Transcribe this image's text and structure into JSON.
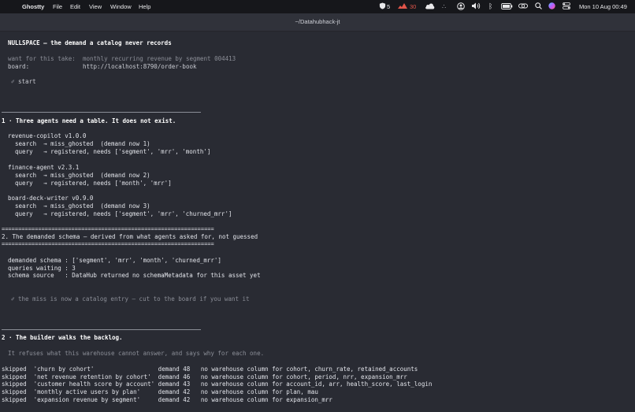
{
  "menubar": {
    "app_name": "Ghostty",
    "menus": [
      "File",
      "Edit",
      "View",
      "Window",
      "Help"
    ],
    "status": {
      "ghost_count": "5",
      "temp": "30",
      "datetime": "Mon 10 Aug  00:49"
    }
  },
  "window": {
    "title": "~/Datahubhack-jt"
  },
  "terminal": {
    "header": "NULLSPACE — the demand a catalog never records",
    "want_label": "want for this take:",
    "want_value": "monthly recurring revenue by segment 004413",
    "board_label": "board:",
    "board_value": "http://localhost:8790/order-book",
    "start": "start",
    "s1_title": "1 · Three agents need a table. It does not exist.",
    "agents": [
      {
        "name": "revenue-copilot v1.0.0",
        "search": "  search  → miss_ghosted  (demand now 1)",
        "query": "  query   → registered, needs ['segment', 'mrr', 'month']"
      },
      {
        "name": "finance-agent v2.3.1",
        "search": "  search  → miss_ghosted  (demand now 2)",
        "query": "  query   → registered, needs ['month', 'mrr']"
      },
      {
        "name": "board-deck-writer v0.9.0",
        "search": "  search  → miss_ghosted  (demand now 3)",
        "query": "  query   → registered, needs ['segment', 'mrr', 'churned_mrr']"
      }
    ],
    "equals_rule": "================================================================",
    "s2_title": "2. The demanded schema — derived from what agents asked for, not guessed",
    "schema_lines": [
      "demanded schema : ['segment', 'mrr', 'month', 'churned_mrr']",
      "queries waiting : 3",
      "schema source   : DataHub returned no schemaMetadata for this asset yet"
    ],
    "miss_note": "the miss is now a catalog entry — cut to the board if you want it",
    "s3_title": "2 · The builder walks the backlog.",
    "s3_sub": "It refuses what this warehouse cannot answer, and says why for each one.",
    "backlog": [
      "skipped  'churn by cohort'                  demand 48   no warehouse column for cohort, churn_rate, retained_accounts",
      "skipped  'net revenue retention by cohort'  demand 46   no warehouse column for cohort, period, nrr, expansion_mrr",
      "skipped  'customer health score by account' demand 43   no warehouse column for account_id, arr, health_score, last_login",
      "skipped  'monthly active users by plan'     demand 42   no warehouse column for plan, mau",
      "skipped  'expansion revenue by segment'     demand 42   no warehouse column for expansion_mrr"
    ]
  }
}
